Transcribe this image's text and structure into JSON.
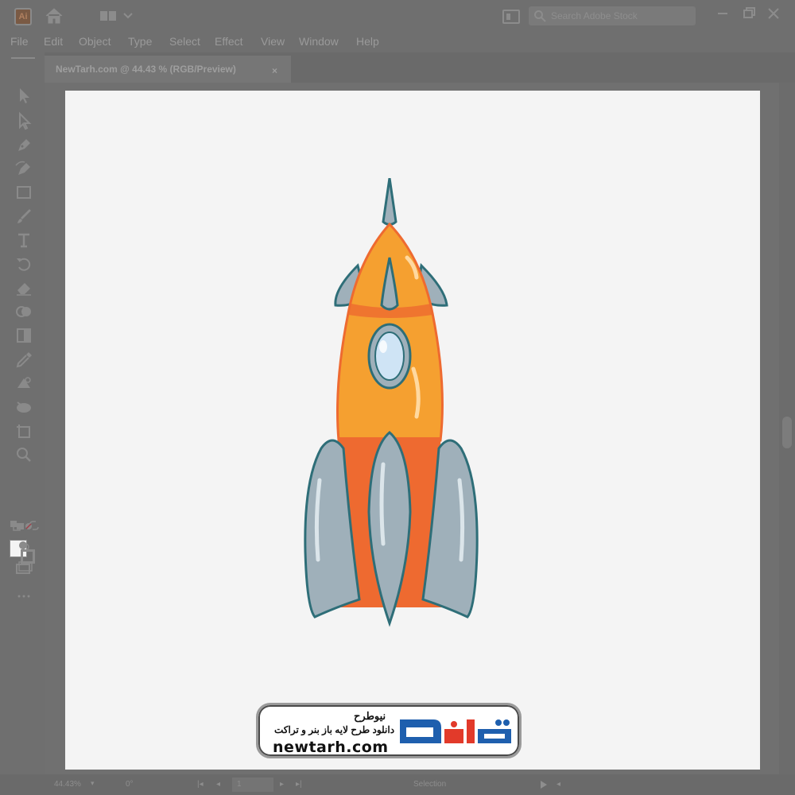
{
  "window": {
    "app_icon_label": "Ai",
    "search_placeholder": "Search Adobe Stock"
  },
  "menu": {
    "items": [
      "File",
      "Edit",
      "Object",
      "Type",
      "Select",
      "Effect",
      "View",
      "Window",
      "Help"
    ]
  },
  "document_tab": {
    "title": "NewTarh.com @ 44.43 % (RGB/Preview)",
    "close": "×"
  },
  "toolbar": {
    "tools": [
      "selection-tool",
      "direct-selection-tool",
      "pen-tool",
      "curvature-tool",
      "rectangle-tool",
      "paintbrush-tool",
      "type-tool",
      "rotate-tool",
      "eraser-tool",
      "shape-builder-tool",
      "gradient-tool",
      "eyedropper-tool",
      "blend-tool",
      "symbol-sprayer-tool",
      "artboard-tool",
      "zoom-tool"
    ],
    "fill_color": "#f4f4f4"
  },
  "artwork": {
    "colors": {
      "body": "#f5a030",
      "body_lower": "#ee6a30",
      "outline": "#2e6e78",
      "fins": "#9fb0ba",
      "window": "#cfe4f5"
    }
  },
  "watermark": {
    "fa_title": "نیوطرح",
    "fa_subtitle": "دانلود طرح لایه باز بنر و تراکت",
    "url": "newtarh.com",
    "brand": "نیوطرح",
    "brand_colors": [
      "#1e5fae",
      "#e23a2a"
    ]
  },
  "statusbar": {
    "zoom": "44.43%",
    "rotation": "0°",
    "artboard_number": "1",
    "current_tool": "Selection"
  }
}
